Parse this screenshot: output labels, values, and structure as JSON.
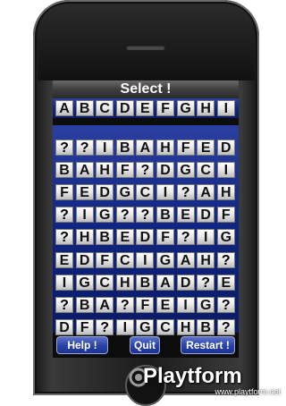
{
  "screen": {
    "title": "Select !",
    "top_letters": [
      "A",
      "B",
      "C",
      "D",
      "E",
      "F",
      "G",
      "H",
      "I"
    ],
    "grid": [
      [
        "?",
        "?",
        "I",
        "B",
        "A",
        "H",
        "F",
        "E",
        "D"
      ],
      [
        "B",
        "A",
        "H",
        "F",
        "?",
        "D",
        "G",
        "C",
        "I"
      ],
      [
        "F",
        "E",
        "D",
        "G",
        "C",
        "I",
        "?",
        "A",
        "H"
      ],
      [
        "?",
        "I",
        "G",
        "?",
        "?",
        "B",
        "E",
        "D",
        "F"
      ],
      [
        "?",
        "H",
        "B",
        "E",
        "D",
        "F",
        "?",
        "I",
        "G"
      ],
      [
        "E",
        "D",
        "F",
        "C",
        "I",
        "G",
        "A",
        "H",
        "?"
      ],
      [
        "I",
        "G",
        "C",
        "H",
        "B",
        "A",
        "D",
        "?",
        "E"
      ],
      [
        "?",
        "B",
        "A",
        "?",
        "F",
        "E",
        "I",
        "G",
        "?"
      ],
      [
        "D",
        "F",
        "?",
        "I",
        "G",
        "C",
        "H",
        "B",
        "?"
      ]
    ]
  },
  "buttons": {
    "help": "Help !",
    "quit": "Quit",
    "restart": "Restart !"
  },
  "watermark": {
    "name": "Playtform",
    "url": "www.playtform.net"
  }
}
